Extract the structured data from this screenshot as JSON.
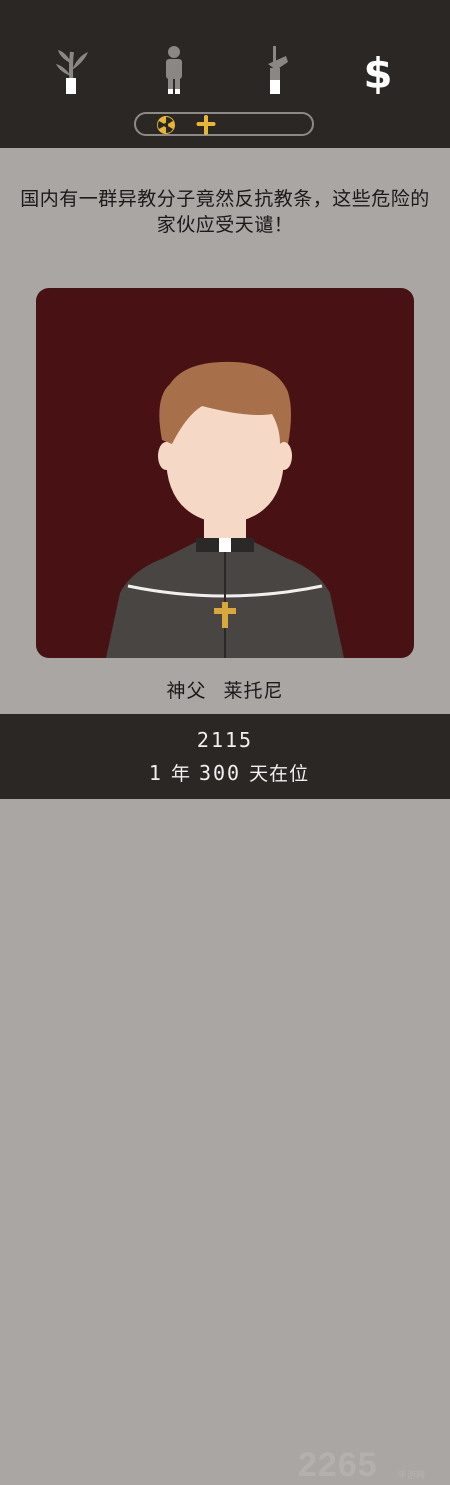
{
  "stats": [
    {
      "icon": "church-branch-icon",
      "level": 0.35
    },
    {
      "icon": "people-figure-icon",
      "level": 0.1
    },
    {
      "icon": "army-rifle-icon",
      "level": 0.3
    },
    {
      "icon": "money-dollar-icon",
      "level": 0.0
    }
  ],
  "indicator": {
    "icons": [
      "radiation-icon",
      "cross-icon"
    ],
    "colors": {
      "accent": "#e8b634"
    }
  },
  "message": "国内有一群异教分子竟然反抗教条，这些危险的家伙应受天谴！",
  "character": {
    "title": "神父",
    "name": "莱托尼"
  },
  "footer": {
    "year": "2115",
    "tenure_years": "1",
    "tenure_year_unit": "年",
    "tenure_days": "300",
    "tenure_day_unit": "天在位"
  },
  "watermark": {
    "text": "2265",
    "sub": "手游网"
  },
  "colors": {
    "top_bar": "#2a2725",
    "background": "#a9a6a3",
    "portrait_bg": "#481214",
    "skin": "#f6d8c6",
    "hair": "#a86f4b",
    "robe": "#494543",
    "cross": "#d8a83a"
  }
}
